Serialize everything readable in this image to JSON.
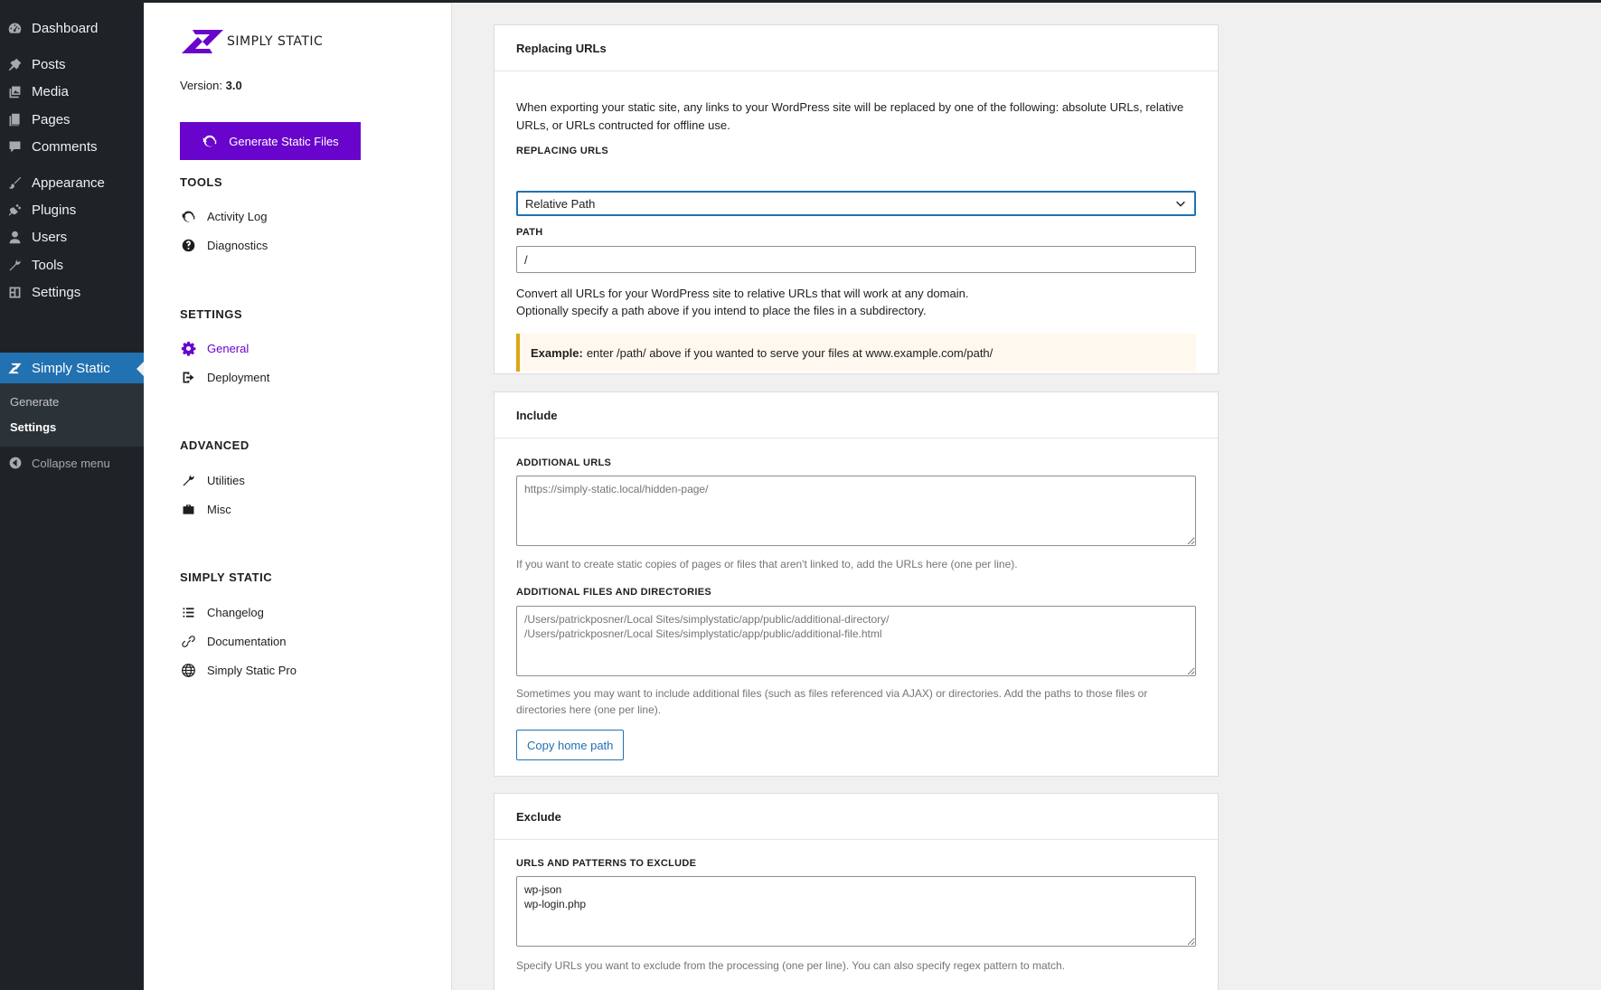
{
  "wp_menu": {
    "items": [
      {
        "label": "Dashboard",
        "icon": "dashboard-icon"
      },
      {
        "label": "Posts",
        "icon": "pin-icon"
      },
      {
        "label": "Media",
        "icon": "media-icon"
      },
      {
        "label": "Pages",
        "icon": "pages-icon"
      },
      {
        "label": "Comments",
        "icon": "comment-icon"
      },
      {
        "label": "Appearance",
        "icon": "brush-icon"
      },
      {
        "label": "Plugins",
        "icon": "plug-icon"
      },
      {
        "label": "Users",
        "icon": "user-icon"
      },
      {
        "label": "Tools",
        "icon": "wrench-icon"
      },
      {
        "label": "Settings",
        "icon": "settings-icon"
      },
      {
        "label": "Simply Static",
        "icon": "simply-static-icon"
      }
    ],
    "submenu": [
      "Generate",
      "Settings"
    ],
    "collapse_label": "Collapse menu"
  },
  "plugin_nav": {
    "logo_text": "SIMPLY STATIC",
    "version_label": "Version:",
    "version_value": "3.0",
    "generate_button": "Generate Static Files",
    "sections": [
      {
        "heading": "TOOLS",
        "links": [
          "Activity Log",
          "Diagnostics"
        ]
      },
      {
        "heading": "SETTINGS",
        "links": [
          "General",
          "Deployment"
        ]
      },
      {
        "heading": "ADVANCED",
        "links": [
          "Utilities",
          "Misc"
        ]
      },
      {
        "heading": "SIMPLY STATIC",
        "links": [
          "Changelog",
          "Documentation",
          "Simply Static Pro"
        ]
      }
    ]
  },
  "replacing": {
    "title": "Replacing URLs",
    "description": "When exporting your static site, any links to your WordPress site will be replaced by one of the following: absolute URLs, relative URLs, or URLs contructed for offline use.",
    "select_label": "REPLACING URLS",
    "select_value": "Relative Path",
    "path_label": "PATH",
    "path_value": "/",
    "help_line1": "Convert all URLs for your WordPress site to relative URLs that will work at any domain.",
    "help_line2": "Optionally specify a path above if you intend to place the files in a subdirectory.",
    "example_bold": "Example:",
    "example_text": "enter /path/ above if you wanted to serve your files at www.example.com/path/"
  },
  "include": {
    "title": "Include",
    "urls_label": "ADDITIONAL URLS",
    "urls_placeholder": "https://simply-static.local/hidden-page/",
    "urls_help": "If you want to create static copies of pages or files that aren't linked to, add the URLs here (one per line).",
    "files_label": "ADDITIONAL FILES AND DIRECTORIES",
    "files_placeholder": "/Users/patrickposner/Local Sites/simplystatic/app/public/additional-directory/\n/Users/patrickposner/Local Sites/simplystatic/app/public/additional-file.html",
    "files_help": "Sometimes you may want to include additional files (such as files referenced via AJAX) or directories. Add the paths to those files or directories here (one per line).",
    "copy_button": "Copy home path"
  },
  "exclude": {
    "title": "Exclude",
    "label": "URLS AND PATTERNS TO EXCLUDE",
    "value": "wp-json\nwp-login.php",
    "help": "Specify URLs you want to exclude from the processing (one per line). You can also specify regex pattern to match."
  },
  "colors": {
    "accent": "#6804cc",
    "wp_blue": "#2271b1",
    "sidebar_bg": "#1d2327"
  }
}
